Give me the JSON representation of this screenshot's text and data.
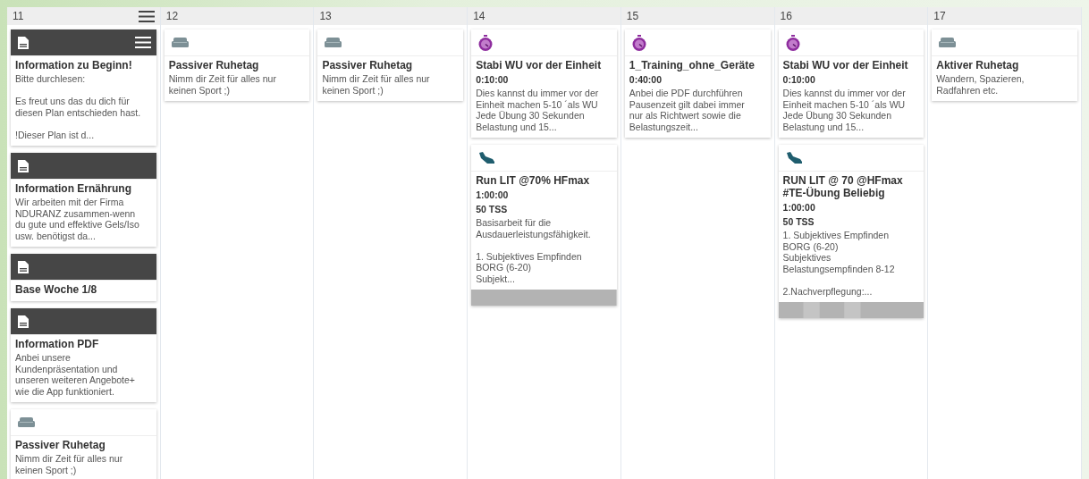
{
  "days": [
    {
      "label": "11",
      "menu": true,
      "cards": [
        {
          "kind": "note",
          "menu": true,
          "title": "Information zu Beginn!",
          "description": "Bitte durchlesen:\n\nEs freut uns das du dich für diesen Plan entschieden hast.\n\n!Dieser Plan ist d..."
        },
        {
          "kind": "note",
          "menu": false,
          "title": "Information Ernährung",
          "description": "Wir arbeiten mit der Firma NDURANZ zusammen-wenn du gute und effektive Gels/Iso usw. benötigst da..."
        },
        {
          "kind": "note",
          "menu": false,
          "title": "Base Woche 1/8"
        },
        {
          "kind": "note",
          "menu": false,
          "title": "Information PDF",
          "description": "Anbei unsere Kundenpräsentation und unseren weiteren Angebote+ wie die App funktioniert."
        },
        {
          "kind": "rest",
          "menu": false,
          "title": "Passiver Ruhetag",
          "description": "Nimm dir Zeit für alles nur keinen Sport ;)"
        }
      ]
    },
    {
      "label": "12",
      "menu": false,
      "cards": [
        {
          "kind": "rest",
          "menu": false,
          "title": "Passiver Ruhetag",
          "description": "Nimm dir Zeit für alles nur keinen Sport ;)"
        }
      ]
    },
    {
      "label": "13",
      "menu": false,
      "cards": [
        {
          "kind": "rest",
          "menu": false,
          "title": "Passiver Ruhetag",
          "description": "Nimm dir Zeit für alles nur keinen Sport ;)"
        }
      ]
    },
    {
      "label": "14",
      "menu": false,
      "cards": [
        {
          "kind": "timer",
          "menu": false,
          "title": "Stabi WU vor der Einheit",
          "duration": "0:10:00",
          "description": "Dies kannst du immer vor der Einheit machen 5-10 ´als WU Jede Übung 30 Sekunden Belastung und 15..."
        },
        {
          "kind": "run",
          "menu": false,
          "title": "Run LIT @70% HFmax",
          "duration": "1:00:00",
          "tss": "50 TSS",
          "description": "Basisarbeit für die Ausdauerleistungsfähigkeit.\n\n1. Subjektives Empfinden BORG (6-20)\nSubjekt..."
        }
      ]
    },
    {
      "label": "15",
      "menu": false,
      "cards": [
        {
          "kind": "timer",
          "menu": false,
          "title": "1_Training_ohne_Geräte",
          "duration": "0:40:00",
          "description": "Anbei die PDF durchführen Pausenzeit gilt dabei immer nur als Richtwert sowie die Belastungszeit..."
        }
      ]
    },
    {
      "label": "16",
      "menu": false,
      "cards": [
        {
          "kind": "timer",
          "menu": false,
          "title": "Stabi WU vor der Einheit",
          "duration": "0:10:00",
          "description": "Dies kannst du immer vor der Einheit machen 5-10 ´als WU Jede Übung 30 Sekunden Belastung und 15..."
        },
        {
          "kind": "run",
          "menu": false,
          "title": "RUN LIT @ 70 @HFmax #TE-Übung Beliebig",
          "duration": "1:00:00",
          "tss": "50 TSS",
          "description": "1. Subjektives Empfinden BORG (6-20)\nSubjektives Belastungsempfinden 8-12\n\n2.Nachverpflegung:..."
        }
      ]
    },
    {
      "label": "17",
      "menu": false,
      "cards": [
        {
          "kind": "rest",
          "menu": false,
          "title": "Aktiver Ruhetag",
          "description": "Wandern, Spazieren, Radfahren etc."
        }
      ]
    }
  ]
}
